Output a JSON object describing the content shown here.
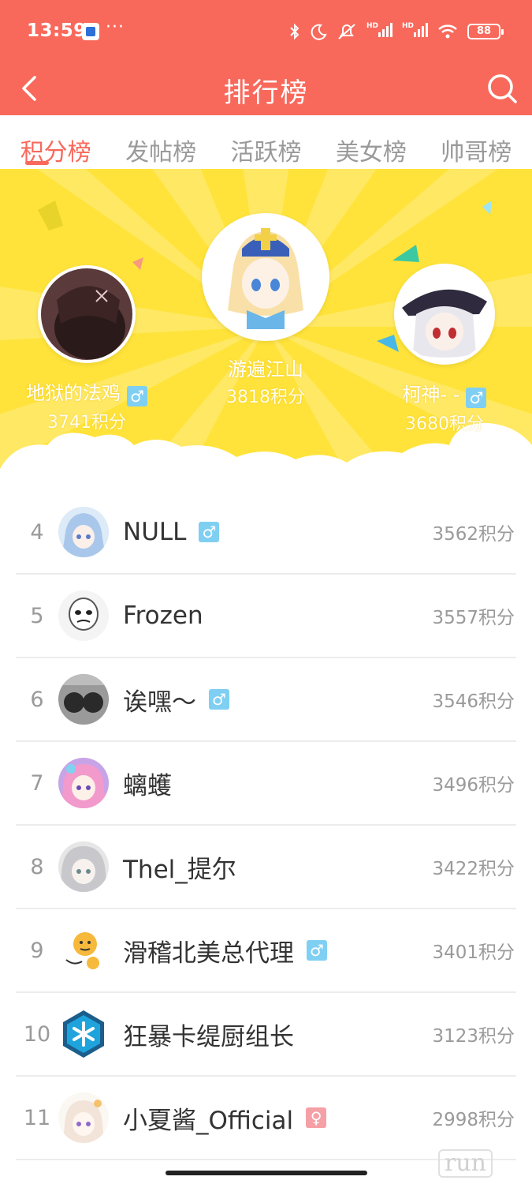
{
  "status_bar": {
    "time": "13:59",
    "more": "···",
    "icons": [
      "bluetooth-icon",
      "moon-icon",
      "mute-icon",
      "signal-icon",
      "signal-icon",
      "wifi-icon"
    ],
    "hd_label": "HD",
    "battery": "88"
  },
  "nav": {
    "title": "排行榜",
    "back_icon": "back-arrow-icon",
    "search_icon": "search-icon"
  },
  "tabs": [
    {
      "label": "积分榜",
      "active": true
    },
    {
      "label": "发帖榜",
      "active": false
    },
    {
      "label": "活跃榜",
      "active": false
    },
    {
      "label": "美女榜",
      "active": false
    },
    {
      "label": "帅哥榜",
      "active": false
    }
  ],
  "podium": {
    "first": {
      "name": "游遍江山",
      "score": "3818积分"
    },
    "second": {
      "name": "地狱的法鸡",
      "score": "3741积分",
      "gender": "♂"
    },
    "third": {
      "name": "柯神- -",
      "score": "3680积分",
      "gender": "♂"
    }
  },
  "rankings": [
    {
      "rank": "4",
      "name": "NULL",
      "gender": "♂",
      "score": "3562积分"
    },
    {
      "rank": "5",
      "name": "Frozen",
      "gender": "",
      "score": "3557积分"
    },
    {
      "rank": "6",
      "name": "诶嘿～",
      "gender": "♂",
      "score": "3546积分"
    },
    {
      "rank": "7",
      "name": "螭蠖",
      "gender": "",
      "score": "3496积分"
    },
    {
      "rank": "8",
      "name": "Thel_提尔",
      "gender": "",
      "score": "3422积分"
    },
    {
      "rank": "9",
      "name": "滑稽北美总代理",
      "gender": "♂",
      "score": "3401积分"
    },
    {
      "rank": "10",
      "name": "狂暴卡缇厨组长",
      "gender": "",
      "score": "3123积分"
    },
    {
      "rank": "11",
      "name": "小夏酱_Official",
      "gender": "♀",
      "score": "2998积分"
    }
  ],
  "watermark": "run",
  "colors": {
    "brand": "#F8695C",
    "podium_bg": "#FFE33A",
    "male": "#7FCFF3",
    "female": "#F5A0A6"
  }
}
